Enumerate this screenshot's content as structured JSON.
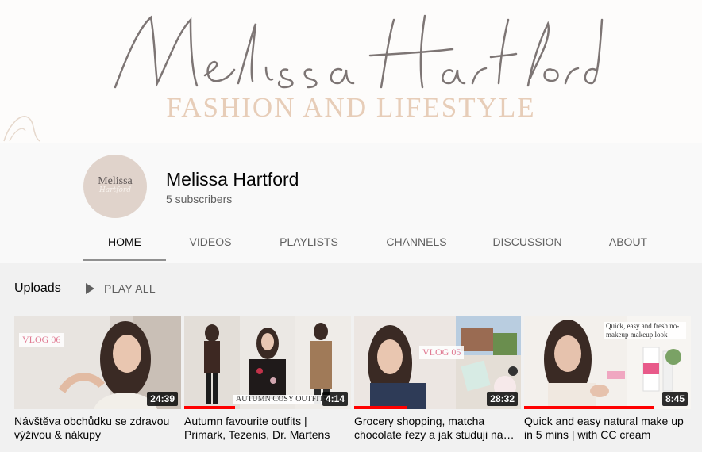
{
  "banner": {
    "script_name": "Melissa Hartford",
    "tagline": "FASHION AND LIFESTYLE"
  },
  "channel": {
    "avatar_line1": "Melissa",
    "avatar_line2": "Hartford",
    "name": "Melissa Hartford",
    "subscribers": "5 subscribers"
  },
  "tabs": [
    {
      "label": "HOME",
      "active": true
    },
    {
      "label": "VIDEOS"
    },
    {
      "label": "PLAYLISTS"
    },
    {
      "label": "CHANNELS"
    },
    {
      "label": "DISCUSSION"
    },
    {
      "label": "ABOUT"
    }
  ],
  "uploads": {
    "title": "Uploads",
    "play_all": "PLAY ALL"
  },
  "videos": [
    {
      "title": "Návštěva obchůdku se zdravou výživou & nákupy",
      "duration": "24:39",
      "overlay": "VLOG 06",
      "watched": 0
    },
    {
      "title": "Autumn favourite outfits | Primark, Tezenis, Dr. Martens",
      "duration": "4:14",
      "overlay": "AUTUMN COSY OUTFITS",
      "watched": 0.3
    },
    {
      "title": "Grocery shopping, matcha chocolate řezy a jak studuji na zkoušky",
      "duration": "28:32",
      "overlay": "VLOG 05",
      "watched": 0.31
    },
    {
      "title": "Quick and easy natural make up in 5 mins | with CC cream",
      "duration": "8:45",
      "overlay": "Quick, easy and fresh no-makeup makeup look",
      "watched": 0.78
    }
  ],
  "colors": {
    "progress": "#ff0000",
    "tagline": "#e7cdb8",
    "avatar_bg": "#e0d3cb"
  }
}
